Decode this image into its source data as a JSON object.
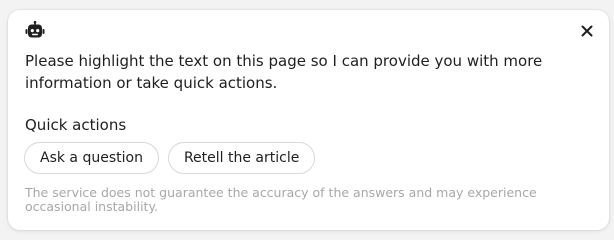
{
  "dialog": {
    "icon": "robot-icon",
    "close_icon": "close-icon",
    "message": "Please highlight the text on this page so I can provide you with more information or take quick actions.",
    "quick_actions": {
      "title": "Quick actions",
      "buttons": [
        {
          "label": "Ask a question"
        },
        {
          "label": "Retell the article"
        }
      ]
    },
    "disclaimer": "The service does not guarantee the accuracy of the answers and may experience occasional instability."
  },
  "colors": {
    "background": "#f3f3f3",
    "card": "#ffffff",
    "text": "#1f1f1f",
    "muted_text": "#a8a8a8",
    "chip_border": "#d9d9d9"
  }
}
